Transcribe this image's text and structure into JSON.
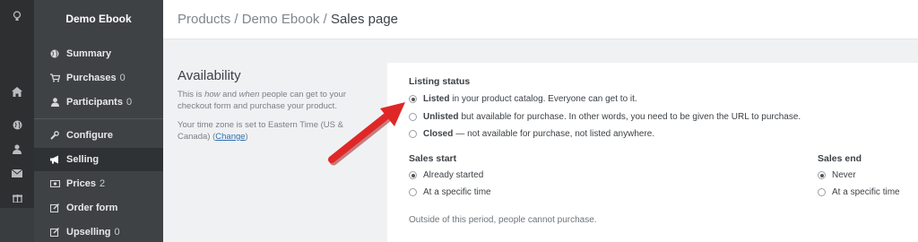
{
  "rail": {
    "icons": [
      "lightbulb-icon",
      "home-icon",
      "globe-icon",
      "user-icon",
      "mail-icon",
      "gift-icon"
    ]
  },
  "sidebar": {
    "title": "Demo Ebook",
    "items": [
      {
        "label": "Summary",
        "count": "",
        "icon": "globe-icon"
      },
      {
        "label": "Purchases",
        "count": "0",
        "icon": "cart-icon"
      },
      {
        "label": "Participants",
        "count": "0",
        "icon": "user-icon"
      },
      {
        "label": "Configure",
        "count": "",
        "icon": "wrench-icon"
      },
      {
        "label": "Selling",
        "count": "",
        "icon": "megaphone-icon"
      },
      {
        "label": "Prices",
        "count": "2",
        "icon": "money-icon"
      },
      {
        "label": "Order form",
        "count": "",
        "icon": "edit-icon"
      },
      {
        "label": "Upselling",
        "count": "0",
        "icon": "edit-icon"
      }
    ]
  },
  "breadcrumb": {
    "part1": "Products",
    "sep": " / ",
    "part2": "Demo Ebook",
    "current": "Sales page"
  },
  "availability": {
    "title": "Availability",
    "desc_pre": "This is ",
    "desc_how": "how",
    "desc_mid": " and ",
    "desc_when": "when",
    "desc_post": " people can get to your checkout form and purchase your product.",
    "tz_text": "Your time zone is set to Eastern Time (US & Canada) ",
    "tz_open": "(",
    "tz_link": "Change",
    "tz_close": ")"
  },
  "listing": {
    "label": "Listing status",
    "options": [
      {
        "strong": "Listed",
        "text": "in your product catalog. Everyone can get to it.",
        "selected": true
      },
      {
        "strong": "Unlisted",
        "text": "but available for purchase. In other words, you need to be given the URL to purchase.",
        "selected": false
      },
      {
        "strong": "Closed",
        "text": "— not available for purchase, not listed anywhere.",
        "selected": false
      }
    ]
  },
  "sales_start": {
    "label": "Sales start",
    "options": [
      "Already started",
      "At a specific time"
    ],
    "selected_index": 0
  },
  "sales_end": {
    "label": "Sales end",
    "options": [
      "Never",
      "At a specific time"
    ],
    "selected_index": 0
  },
  "period_note": "Outside of this period, people cannot purchase."
}
